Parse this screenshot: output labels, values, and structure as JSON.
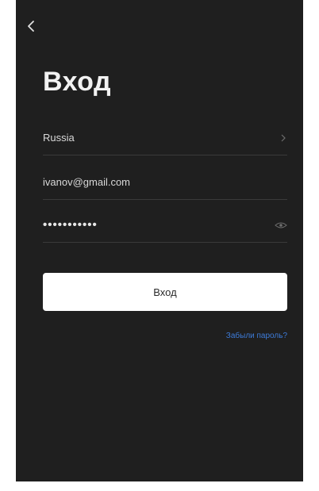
{
  "header": {
    "back_icon": "chevron-left-icon",
    "title": "Вход"
  },
  "form": {
    "country": {
      "value": "Russia",
      "icon": "chevron-right-icon"
    },
    "email": {
      "value": "ivanov@gmail.com"
    },
    "password": {
      "value": "•••••••••••",
      "icon": "eye-icon"
    },
    "submit_label": "Вход",
    "forgot_label": "Забыли пароль?"
  },
  "colors": {
    "background": "#1f1f1f",
    "text": "#f2f2f2",
    "button": "#ffffff",
    "link": "#3d7bd8"
  }
}
